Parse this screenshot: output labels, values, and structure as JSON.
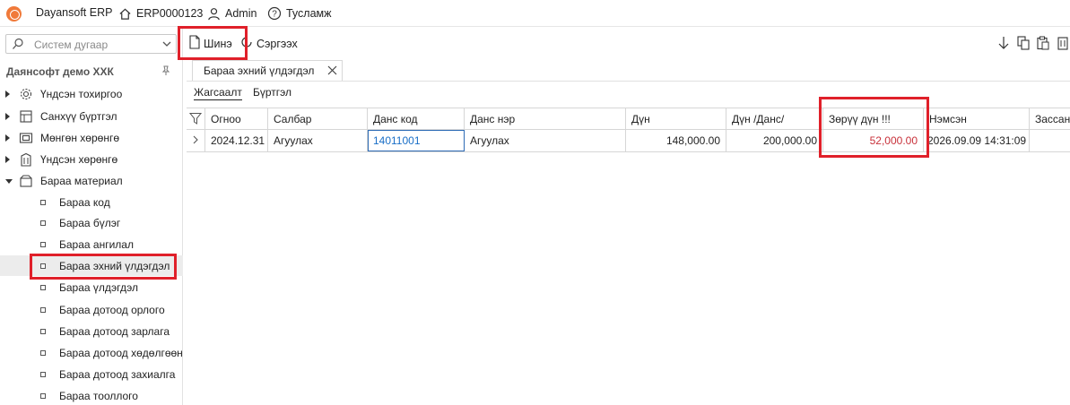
{
  "topbar": {
    "app_name": "Dayansoft ERP",
    "company_code": "ERP0000123",
    "user": "Admin",
    "help": "Тусламж"
  },
  "sidebar": {
    "search_placeholder": "Систем дугаар",
    "company_name": "Даянсофт демо ХХК",
    "groups": [
      {
        "label": "Үндсэн тохиргоо",
        "icon": "gear-icon"
      },
      {
        "label": "Санхүү бүртгэл",
        "icon": "ledger-icon"
      },
      {
        "label": "Мөнгөн хөрөнгө",
        "icon": "money-icon"
      },
      {
        "label": "Үндсэн хөрөнгө",
        "icon": "building-icon"
      },
      {
        "label": "Бараа материал",
        "icon": "box-icon"
      }
    ],
    "sub_items": [
      "Бараа код",
      "Бараа бүлэг",
      "Бараа ангилал",
      "Бараа эхний үлдэгдэл",
      "Бараа үлдэгдэл",
      "Бараа дотоод орлого",
      "Бараа дотоод зарлага",
      "Бараа дотоод хөдөлгөөн",
      "Бараа дотоод захиалга",
      "Бараа тооллого"
    ]
  },
  "toolbar": {
    "new_label": "Шинэ",
    "refresh_label": "Сэргээх"
  },
  "document_tab": {
    "label": "Бараа эхний үлдэгдэл"
  },
  "view_tabs": [
    "Жагсаалт",
    "Бүртгэл"
  ],
  "grid": {
    "columns": [
      "Огноо",
      "Салбар",
      "Данс код",
      "Данс нэр",
      "Дүн",
      "Дүн /Данс/",
      "Зөрүү дүн !!!",
      "Нэмсэн",
      "Зассан"
    ],
    "rows": [
      [
        "2024.12.31",
        "Агуулах",
        "14011001",
        "Агуулах",
        "148,000.00",
        "200,000.00",
        "52,000.00",
        "2026.09.09 14:31:09",
        ""
      ]
    ]
  },
  "colors": {
    "highlight": "#e0202a",
    "link": "#1a6fc7",
    "negative": "#c8313a",
    "logo": "#f07a3a"
  }
}
